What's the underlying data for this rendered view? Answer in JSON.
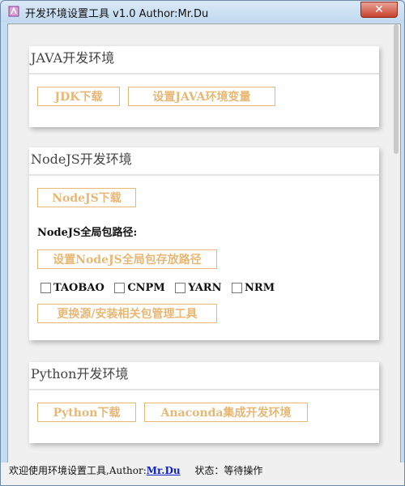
{
  "window": {
    "title": "开发环境设置工具 v1.0 Author:Mr.Du",
    "close_label": "✕"
  },
  "java": {
    "title": "JAVA开发环境",
    "jdk_button": "JDK下载",
    "env_button": "设置JAVA环境变量"
  },
  "nodejs": {
    "title": "NodeJS开发环境",
    "download_button": "NodeJS下载",
    "global_path_label": "NodeJS全局包路径:",
    "set_path_button": "设置NodeJS全局包存放路径",
    "registries": [
      "TAOBAO",
      "CNPM",
      "YARN",
      "NRM"
    ],
    "switch_button": "更换源/安装相关包管理工具"
  },
  "python": {
    "title": "Python开发环境",
    "download_button": "Python下载",
    "anaconda_button": "Anaconda集成开发环境"
  },
  "status": {
    "welcome": "欢迎使用环境设置工具,Author:",
    "author_link": "Mr.Du",
    "state": "状态：等待操作"
  },
  "colors": {
    "accent": "#e9b774",
    "link": "#1020c8"
  }
}
